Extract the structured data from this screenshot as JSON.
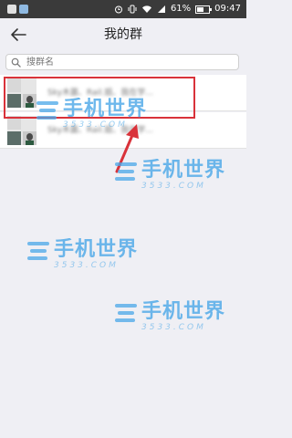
{
  "status_bar": {
    "battery_text": "61%",
    "battery_level": 0.61,
    "time": "09:47",
    "icons": [
      "app-icon",
      "app-icon",
      "alarm-icon",
      "vibrate-icon",
      "wifi-icon",
      "signal-icon",
      "battery-icon"
    ]
  },
  "header": {
    "title": "我的群",
    "back_icon": "back-arrow-icon"
  },
  "search": {
    "placeholder": "搜群名",
    "icon": "search-icon"
  },
  "groups": [
    {
      "name": "Sky木菌、Rail.姐、我在学...",
      "highlighted": true
    },
    {
      "name": "Sky木菌、Rail.姐、我在学...",
      "highlighted": false
    }
  ],
  "watermark": {
    "brand_cn": "手机世界",
    "brand_en": "3533.COM"
  },
  "colors": {
    "status_bar_bg": "#3a3a3a",
    "page_bg": "#efeff4",
    "highlight": "#d9323a",
    "watermark": "#4aa7e8"
  }
}
